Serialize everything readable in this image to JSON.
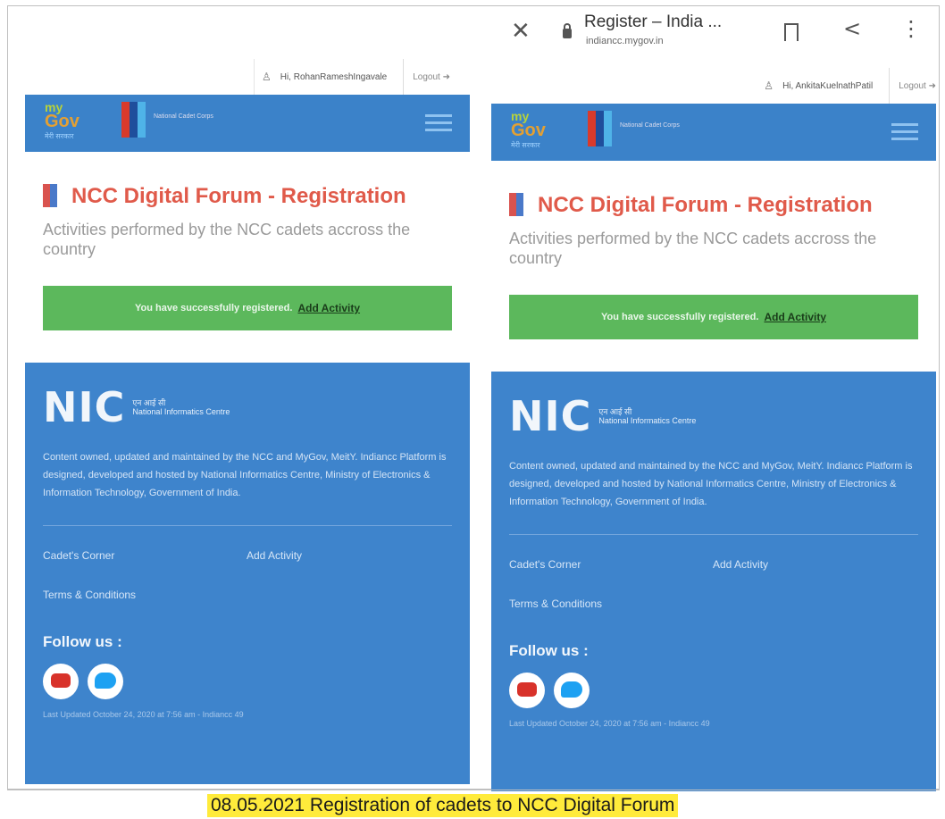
{
  "browser": {
    "title": "Register – India ...",
    "url": "indiancc.mygov.in"
  },
  "screens": [
    {
      "user": "Hi, RohanRameshIngavale",
      "logout": "Logout",
      "logo_my": "my",
      "logo_gov": "Gov",
      "logo_tag": "मेरी सरकार",
      "ncc_name": "National Cadet Corps",
      "title": "NCC Digital Forum - Registration",
      "subtitle": "Activities performed by the NCC cadets accross the country",
      "success_text": "You have successfully registered.",
      "success_link": "Add Activity",
      "nic_hindi": "एन आई सी",
      "nic_name": "National Informatics Centre",
      "nic_mark": "NIC",
      "footer_text": "Content owned, updated and maintained by the NCC and MyGov, MeitY. Indiancc Platform is designed, developed and hosted by National Informatics Centre, Ministry of Electronics & Information Technology, Government of India.",
      "link_cadets": "Cadet's Corner",
      "link_add": "Add Activity",
      "link_terms": "Terms & Conditions",
      "follow": "Follow us :",
      "updated": "Last Updated October 24, 2020 at 7:56 am - Indiancc 49"
    },
    {
      "user": "Hi, AnkitaKuelnathPatil",
      "logout": "Logout",
      "logo_my": "my",
      "logo_gov": "Gov",
      "logo_tag": "मेरी सरकार",
      "ncc_name": "National Cadet Corps",
      "title": "NCC Digital Forum - Registration",
      "subtitle": "Activities performed by the NCC cadets accross the country",
      "success_text": "You have successfully registered.",
      "success_link": "Add Activity",
      "nic_hindi": "एन आई सी",
      "nic_name": "National Informatics Centre",
      "nic_mark": "NIC",
      "footer_text": "Content owned, updated and maintained by the NCC and MyGov, MeitY. Indiancc Platform is designed, developed and hosted by National Informatics Centre, Ministry of Electronics & Information Technology, Government of India.",
      "link_cadets": "Cadet's Corner",
      "link_add": "Add Activity",
      "link_terms": "Terms & Conditions",
      "follow": "Follow us :",
      "updated": "Last Updated October 24, 2020 at 7:56 am - Indiancc 49"
    }
  ],
  "caption": "08.05.2021 Registration of cadets to NCC Digital Forum"
}
